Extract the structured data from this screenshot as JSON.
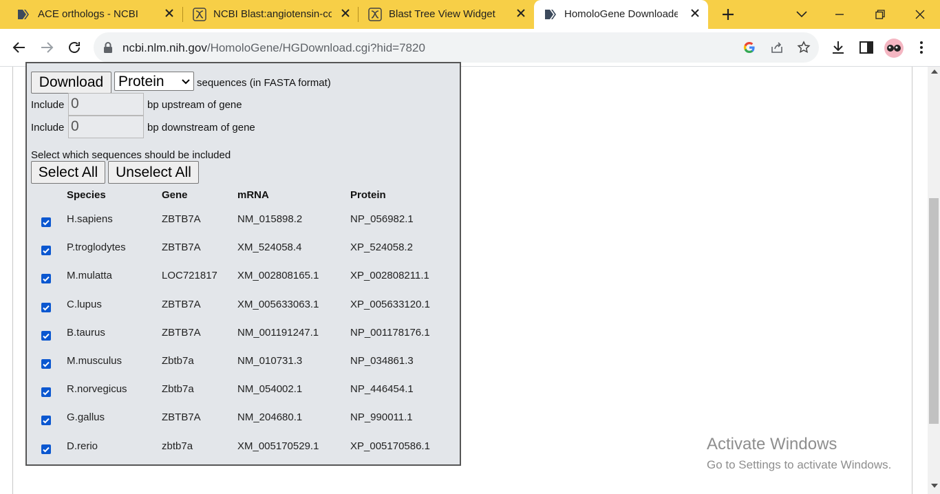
{
  "browser": {
    "tabs": [
      {
        "title": "ACE orthologs - NCBI",
        "active": false
      },
      {
        "title": "NCBI Blast:angiotensin-con",
        "active": false
      },
      {
        "title": "Blast Tree View Widget",
        "active": false
      },
      {
        "title": "HomoloGene Downloader",
        "active": true
      }
    ],
    "url_host": "ncbi.nlm.nih.gov",
    "url_path": "/HomoloGene/HGDownload.cgi?hid=7820"
  },
  "form": {
    "download_label": "Download",
    "sequence_type": "Protein",
    "format_text": "sequences (in FASTA format)",
    "include_label": "Include",
    "upstream_value": "0",
    "upstream_text": "bp upstream of gene",
    "downstream_value": "0",
    "downstream_text": "bp downstream of gene",
    "select_prompt": "Select which sequences should be included",
    "select_all_label": "Select All",
    "unselect_all_label": "Unselect All"
  },
  "table": {
    "headers": [
      "Species",
      "Gene",
      "mRNA",
      "Protein"
    ],
    "rows": [
      {
        "checked": true,
        "species": "H.sapiens",
        "gene": "ZBTB7A",
        "mrna": "NM_015898.2",
        "protein": "NP_056982.1"
      },
      {
        "checked": true,
        "species": "P.troglodytes",
        "gene": "ZBTB7A",
        "mrna": "XM_524058.4",
        "protein": "XP_524058.2"
      },
      {
        "checked": true,
        "species": "M.mulatta",
        "gene": "LOC721817",
        "mrna": "XM_002808165.1",
        "protein": "XP_002808211.1"
      },
      {
        "checked": true,
        "species": "C.lupus",
        "gene": "ZBTB7A",
        "mrna": "XM_005633063.1",
        "protein": "XP_005633120.1"
      },
      {
        "checked": true,
        "species": "B.taurus",
        "gene": "ZBTB7A",
        "mrna": "NM_001191247.1",
        "protein": "NP_001178176.1"
      },
      {
        "checked": true,
        "species": "M.musculus",
        "gene": "Zbtb7a",
        "mrna": "NM_010731.3",
        "protein": "NP_034861.3"
      },
      {
        "checked": true,
        "species": "R.norvegicus",
        "gene": "Zbtb7a",
        "mrna": "NM_054002.1",
        "protein": "NP_446454.1"
      },
      {
        "checked": true,
        "species": "G.gallus",
        "gene": "ZBTB7A",
        "mrna": "NM_204680.1",
        "protein": "NP_990011.1"
      },
      {
        "checked": true,
        "species": "D.rerio",
        "gene": "zbtb7a",
        "mrna": "XM_005170529.1",
        "protein": "XP_005170586.1"
      }
    ]
  },
  "watermark": {
    "line1": "Activate Windows",
    "line2": "Go to Settings to activate Windows."
  },
  "colors": {
    "tabstrip": "#f7cf47",
    "panel": "#e3e6ea",
    "checkbox": "#0b57d0"
  }
}
